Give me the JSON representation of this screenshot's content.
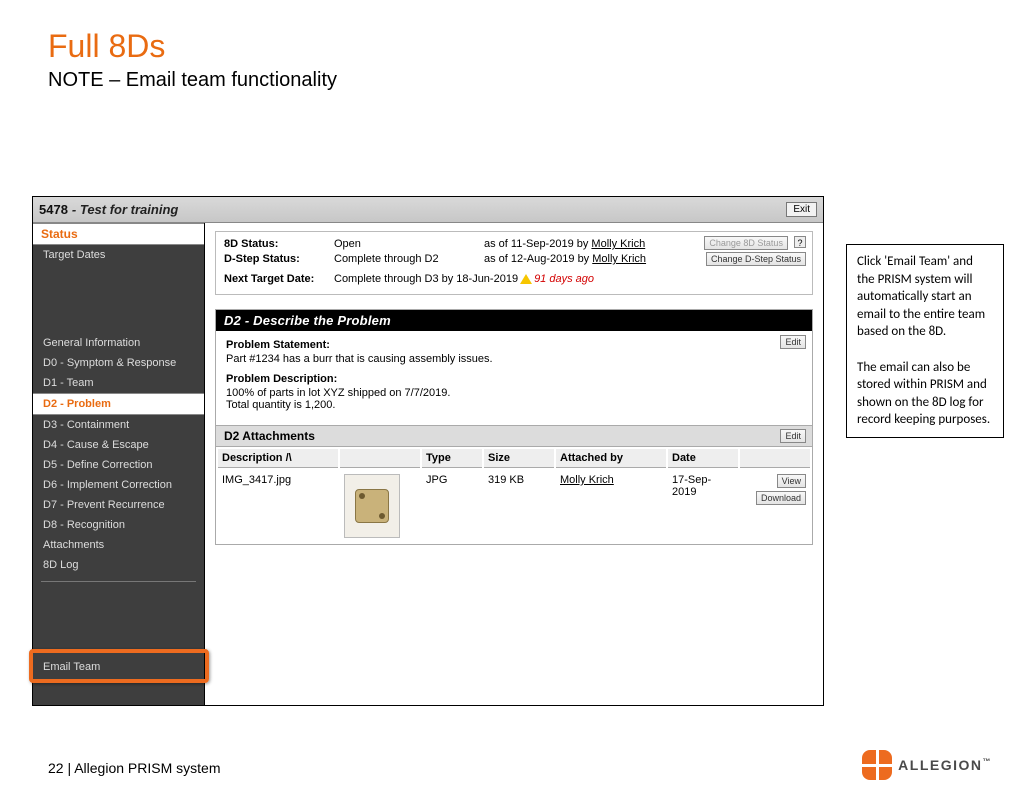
{
  "slide": {
    "title": "Full 8Ds",
    "subtitle": "NOTE – Email team functionality"
  },
  "header": {
    "record_id": "5478",
    "record_title": " - Test for training",
    "exit": "Exit"
  },
  "sidebar": {
    "status_label": "Status",
    "target_dates": "Target Dates",
    "items": [
      "General Information",
      "D0 - Symptom & Response",
      "D1 - Team",
      "D2 - Problem",
      "D3 - Containment",
      "D4 - Cause & Escape",
      "D5 - Define Correction",
      "D6 - Implement Correction",
      "D7 - Prevent Recurrence",
      "D8 - Recognition",
      "Attachments",
      "8D Log"
    ],
    "selected_index": 3,
    "email_team": "Email Team"
  },
  "status": {
    "row1_label": "8D Status:",
    "row1_value": "Open",
    "row1_asof": "as of 11-Sep-2019 by ",
    "row1_user": "Molly Krich",
    "row2_label": "D-Step Status:",
    "row2_value": "Complete through D2",
    "row2_asof": "as of 12-Aug-2019 by ",
    "row2_user": "Molly Krich",
    "change_8d": "Change 8D Status",
    "change_dstep": "Change D-Step Status",
    "next_label": "Next Target Date:",
    "next_value": "Complete through D3 by 18-Jun-2019",
    "overdue": "91 days ago"
  },
  "d2": {
    "heading": "D2 - Describe the Problem",
    "ps_label": "Problem Statement:",
    "ps_text": "Part #1234 has a burr that is causing assembly issues.",
    "pd_label": "Problem Description:",
    "pd_line1": "100% of parts in lot XYZ shipped on 7/7/2019.",
    "pd_line2": "Total quantity is 1,200.",
    "edit": "Edit",
    "att_head": "D2 Attachments",
    "cols": {
      "desc": "Description /\\",
      "type": "Type",
      "size": "Size",
      "by": "Attached by",
      "date": "Date"
    },
    "row": {
      "desc": "IMG_3417.jpg",
      "type": "JPG",
      "size": "319 KB",
      "by": "Molly Krich",
      "date": "17-Sep-2019",
      "view": "View",
      "download": "Download"
    }
  },
  "callout": {
    "p1": "Click 'Email Team' and the PRISM system will automatically start an email to the entire team based on the 8D.",
    "p2": "The email can also be stored within PRISM and shown on the 8D log for record keeping purposes."
  },
  "footer": "22 | Allegion PRISM system",
  "logo_text": "ALLEGION"
}
